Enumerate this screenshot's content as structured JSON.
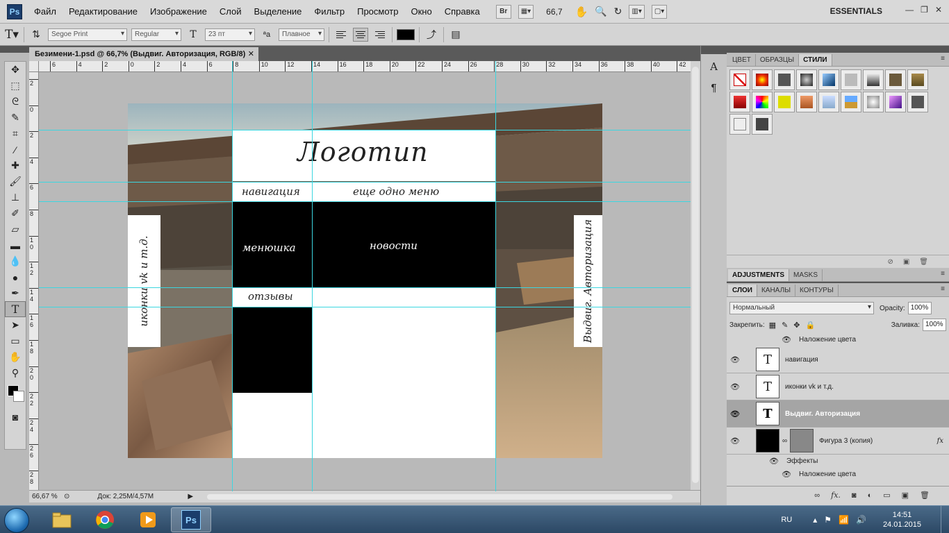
{
  "app": {
    "logo": "Ps",
    "menu": [
      "Файл",
      "Редактирование",
      "Изображение",
      "Слой",
      "Выделение",
      "Фильтр",
      "Просмотр",
      "Окно",
      "Справка"
    ],
    "bridge_label": "Br",
    "zoom": "66,7",
    "workspace": "ESSENTIALS"
  },
  "options": {
    "font_family": "Segoe Print",
    "font_style": "Regular",
    "font_size": "23 пт",
    "aa_label": "ªa",
    "anti_alias": "Плавное",
    "text_color": "#000000"
  },
  "document": {
    "tab_title": "Безимени-1.psd @ 66,7% (Выдвиг. Авторизация, RGB/8)",
    "close": "✕",
    "ruler_h": [
      "6",
      "4",
      "2",
      "0",
      "2",
      "4",
      "6",
      "8",
      "10",
      "12",
      "14",
      "16",
      "18",
      "20",
      "22",
      "24",
      "26",
      "28",
      "30",
      "32",
      "34",
      "36",
      "38",
      "40",
      "42"
    ],
    "ruler_v": [
      "2",
      "0",
      "2",
      "4",
      "6",
      "8",
      "1\n0",
      "1\n2",
      "1\n4",
      "1\n6",
      "1\n8",
      "2\n0",
      "2\n2",
      "2\n4",
      "2\n6",
      "2\n8"
    ],
    "status_zoom": "66,67 %",
    "status_doc": "Док: 2,25M/4,57M"
  },
  "canvas": {
    "logo": "Логотип",
    "nav": "навигация",
    "menu2": "еще одно меню",
    "menushka": "менюшка",
    "news": "новости",
    "reviews": "отзывы",
    "left_vertical": "иконки vk и т.д.",
    "right_vertical": "Выдвиг. Авторизация"
  },
  "panels": {
    "top_tabs": [
      "ЦВЕТ",
      "ОБРАЗЦЫ",
      "СТИЛИ"
    ],
    "adj_tabs": [
      "ADJUSTMENTS",
      "MASKS"
    ],
    "layer_tabs": [
      "СЛОИ",
      "КАНАЛЫ",
      "КОНТУРЫ"
    ],
    "blend_mode": "Нормальный",
    "opacity_label": "Opacity:",
    "opacity": "100%",
    "lock_label": "Закрепить:",
    "fill_label": "Заливка:",
    "fill": "100%",
    "layers": {
      "overlay1": "Наложение цвета",
      "l_nav": "навигация",
      "l_icons": "иконки vk и т.д.",
      "l_auth": "Выдвиг. Авторизация",
      "l_shape": "Фигура 3 (копия)",
      "effects": "Эффекты",
      "overlay2": "Наложение цвета",
      "fx": "fx"
    }
  },
  "taskbar": {
    "lang": "RU",
    "time": "14:51",
    "date": "24.01.2015",
    "ps": "Ps"
  }
}
